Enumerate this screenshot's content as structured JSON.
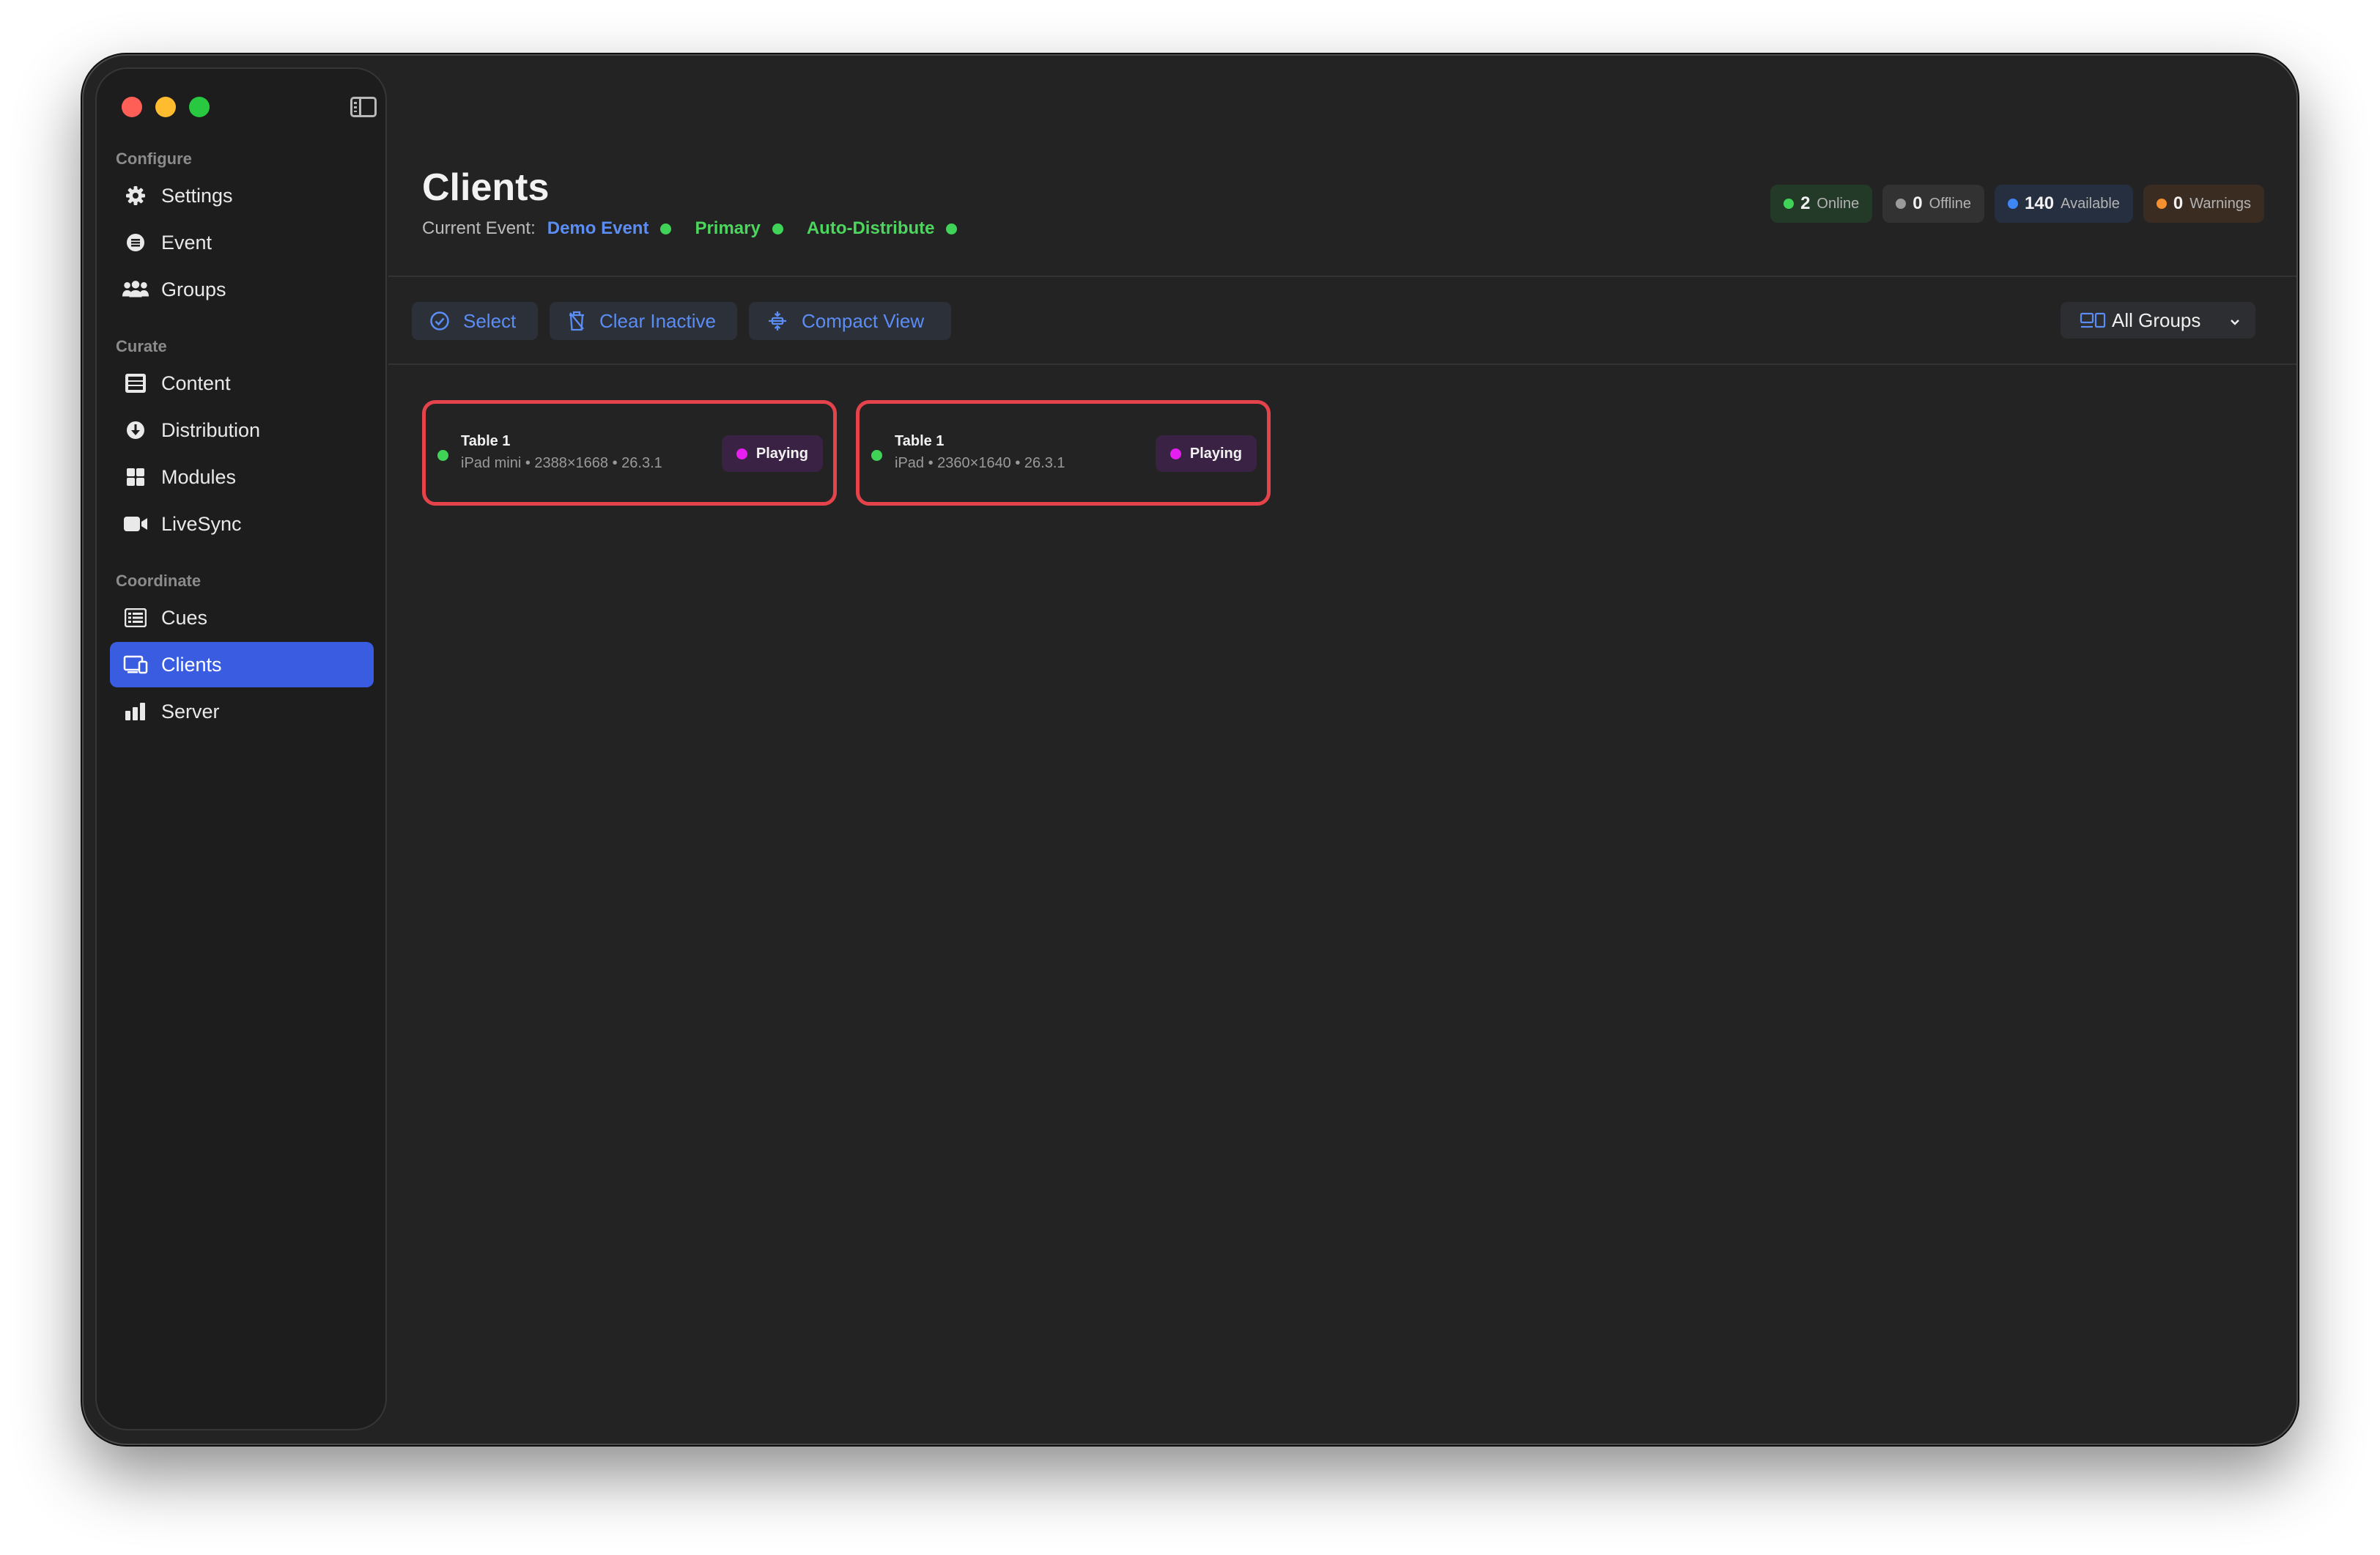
{
  "sidebar": {
    "sections": [
      {
        "label": "Configure"
      },
      {
        "label": "Curate"
      },
      {
        "label": "Coordinate"
      }
    ],
    "items": [
      {
        "label": "Settings",
        "icon": "gear-icon"
      },
      {
        "label": "Event",
        "icon": "event-icon"
      },
      {
        "label": "Groups",
        "icon": "people-icon"
      },
      {
        "label": "Content",
        "icon": "film-icon"
      },
      {
        "label": "Distribution",
        "icon": "download-icon"
      },
      {
        "label": "Modules",
        "icon": "grid-icon"
      },
      {
        "label": "LiveSync",
        "icon": "video-camera-icon"
      },
      {
        "label": "Cues",
        "icon": "list-icon"
      },
      {
        "label": "Clients",
        "icon": "devices-icon",
        "active": true
      },
      {
        "label": "Server",
        "icon": "bar-chart-icon"
      }
    ]
  },
  "header": {
    "title": "Clients",
    "current_event_label": "Current Event:",
    "current_event": "Demo Event",
    "primary": "Primary",
    "auto_distribute": "Auto-Distribute"
  },
  "stats": [
    {
      "value": "2",
      "label": "Online",
      "color": "#3fd457",
      "bg": "#243a28"
    },
    {
      "value": "0",
      "label": "Offline",
      "color": "#9a9a9a",
      "bg": "#323232"
    },
    {
      "value": "140",
      "label": "Available",
      "color": "#3f86f5",
      "bg": "#262f3f"
    },
    {
      "value": "0",
      "label": "Warnings",
      "color": "#f5902e",
      "bg": "#3b2c22"
    }
  ],
  "toolbar": {
    "select_label": "Select",
    "clear_inactive_label": "Clear Inactive",
    "compact_view_label": "Compact View",
    "groups_filter_value": "All Groups"
  },
  "clients": [
    {
      "name": "Table 1",
      "info": "iPad mini • 2388×1668 • 26.3.1",
      "status": "Playing",
      "online": true
    },
    {
      "name": "Table 1",
      "info": "iPad • 2360×1640 • 26.3.1",
      "status": "Playing",
      "online": true
    }
  ],
  "colors": {
    "accent": "#3a5ce0",
    "link": "#5b8df5",
    "online": "#3fd457",
    "playing": "#e61ef0",
    "highlight": "#e5434c"
  }
}
